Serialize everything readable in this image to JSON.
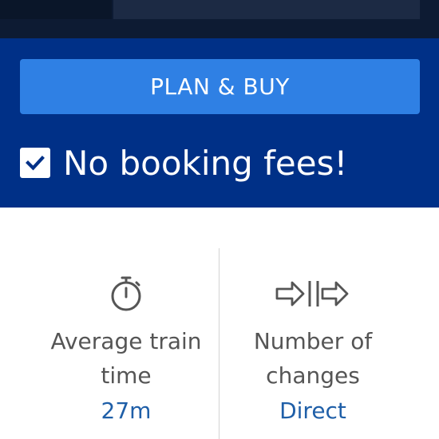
{
  "purchase_panel": {
    "plan_button_label": "PLAN & BUY",
    "no_fees_label": "No booking fees!",
    "no_fees_checked": true
  },
  "stats": [
    {
      "icon": "stopwatch-icon",
      "label_line1": "Average train",
      "label_line2": "time",
      "value": "27m"
    },
    {
      "icon": "changes-arrows-icon",
      "label_line1": "Number of",
      "label_line2": "changes",
      "value": "Direct"
    }
  ],
  "colors": {
    "panel_background": "#003087",
    "button_background": "#2f80e4",
    "value_text": "#1f5fa8",
    "label_text": "#555555"
  }
}
